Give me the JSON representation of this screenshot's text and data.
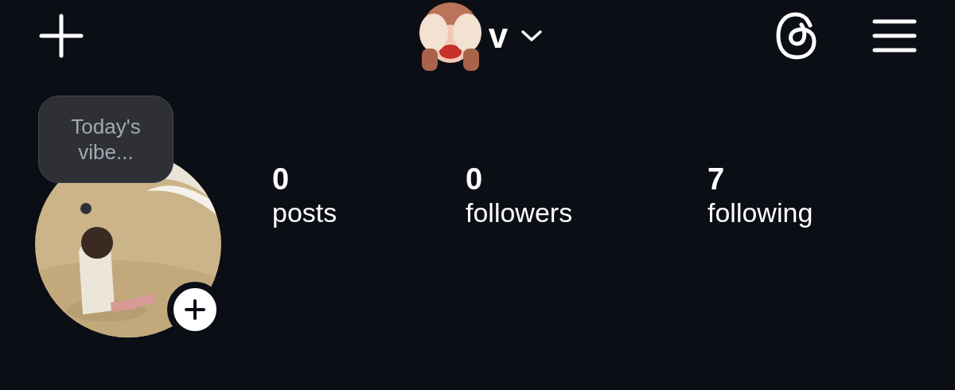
{
  "header": {
    "username": "v"
  },
  "note": {
    "text": "Today's vibe..."
  },
  "stats": [
    {
      "value": "0",
      "label": "posts"
    },
    {
      "value": "0",
      "label": "followers"
    },
    {
      "value": "7",
      "label": "following"
    }
  ]
}
